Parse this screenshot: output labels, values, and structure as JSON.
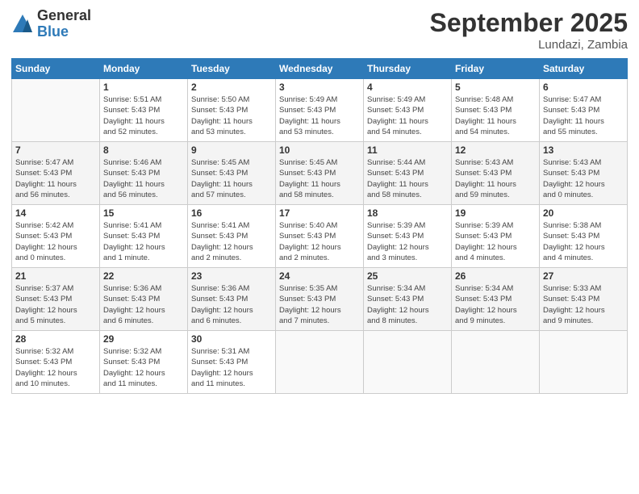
{
  "logo": {
    "general": "General",
    "blue": "Blue"
  },
  "title": "September 2025",
  "subtitle": "Lundazi, Zambia",
  "weekdays": [
    "Sunday",
    "Monday",
    "Tuesday",
    "Wednesday",
    "Thursday",
    "Friday",
    "Saturday"
  ],
  "weeks": [
    [
      {
        "num": "",
        "info": ""
      },
      {
        "num": "1",
        "info": "Sunrise: 5:51 AM\nSunset: 5:43 PM\nDaylight: 11 hours\nand 52 minutes."
      },
      {
        "num": "2",
        "info": "Sunrise: 5:50 AM\nSunset: 5:43 PM\nDaylight: 11 hours\nand 53 minutes."
      },
      {
        "num": "3",
        "info": "Sunrise: 5:49 AM\nSunset: 5:43 PM\nDaylight: 11 hours\nand 53 minutes."
      },
      {
        "num": "4",
        "info": "Sunrise: 5:49 AM\nSunset: 5:43 PM\nDaylight: 11 hours\nand 54 minutes."
      },
      {
        "num": "5",
        "info": "Sunrise: 5:48 AM\nSunset: 5:43 PM\nDaylight: 11 hours\nand 54 minutes."
      },
      {
        "num": "6",
        "info": "Sunrise: 5:47 AM\nSunset: 5:43 PM\nDaylight: 11 hours\nand 55 minutes."
      }
    ],
    [
      {
        "num": "7",
        "info": "Sunrise: 5:47 AM\nSunset: 5:43 PM\nDaylight: 11 hours\nand 56 minutes."
      },
      {
        "num": "8",
        "info": "Sunrise: 5:46 AM\nSunset: 5:43 PM\nDaylight: 11 hours\nand 56 minutes."
      },
      {
        "num": "9",
        "info": "Sunrise: 5:45 AM\nSunset: 5:43 PM\nDaylight: 11 hours\nand 57 minutes."
      },
      {
        "num": "10",
        "info": "Sunrise: 5:45 AM\nSunset: 5:43 PM\nDaylight: 11 hours\nand 58 minutes."
      },
      {
        "num": "11",
        "info": "Sunrise: 5:44 AM\nSunset: 5:43 PM\nDaylight: 11 hours\nand 58 minutes."
      },
      {
        "num": "12",
        "info": "Sunrise: 5:43 AM\nSunset: 5:43 PM\nDaylight: 11 hours\nand 59 minutes."
      },
      {
        "num": "13",
        "info": "Sunrise: 5:43 AM\nSunset: 5:43 PM\nDaylight: 12 hours\nand 0 minutes."
      }
    ],
    [
      {
        "num": "14",
        "info": "Sunrise: 5:42 AM\nSunset: 5:43 PM\nDaylight: 12 hours\nand 0 minutes."
      },
      {
        "num": "15",
        "info": "Sunrise: 5:41 AM\nSunset: 5:43 PM\nDaylight: 12 hours\nand 1 minute."
      },
      {
        "num": "16",
        "info": "Sunrise: 5:41 AM\nSunset: 5:43 PM\nDaylight: 12 hours\nand 2 minutes."
      },
      {
        "num": "17",
        "info": "Sunrise: 5:40 AM\nSunset: 5:43 PM\nDaylight: 12 hours\nand 2 minutes."
      },
      {
        "num": "18",
        "info": "Sunrise: 5:39 AM\nSunset: 5:43 PM\nDaylight: 12 hours\nand 3 minutes."
      },
      {
        "num": "19",
        "info": "Sunrise: 5:39 AM\nSunset: 5:43 PM\nDaylight: 12 hours\nand 4 minutes."
      },
      {
        "num": "20",
        "info": "Sunrise: 5:38 AM\nSunset: 5:43 PM\nDaylight: 12 hours\nand 4 minutes."
      }
    ],
    [
      {
        "num": "21",
        "info": "Sunrise: 5:37 AM\nSunset: 5:43 PM\nDaylight: 12 hours\nand 5 minutes."
      },
      {
        "num": "22",
        "info": "Sunrise: 5:36 AM\nSunset: 5:43 PM\nDaylight: 12 hours\nand 6 minutes."
      },
      {
        "num": "23",
        "info": "Sunrise: 5:36 AM\nSunset: 5:43 PM\nDaylight: 12 hours\nand 6 minutes."
      },
      {
        "num": "24",
        "info": "Sunrise: 5:35 AM\nSunset: 5:43 PM\nDaylight: 12 hours\nand 7 minutes."
      },
      {
        "num": "25",
        "info": "Sunrise: 5:34 AM\nSunset: 5:43 PM\nDaylight: 12 hours\nand 8 minutes."
      },
      {
        "num": "26",
        "info": "Sunrise: 5:34 AM\nSunset: 5:43 PM\nDaylight: 12 hours\nand 9 minutes."
      },
      {
        "num": "27",
        "info": "Sunrise: 5:33 AM\nSunset: 5:43 PM\nDaylight: 12 hours\nand 9 minutes."
      }
    ],
    [
      {
        "num": "28",
        "info": "Sunrise: 5:32 AM\nSunset: 5:43 PM\nDaylight: 12 hours\nand 10 minutes."
      },
      {
        "num": "29",
        "info": "Sunrise: 5:32 AM\nSunset: 5:43 PM\nDaylight: 12 hours\nand 11 minutes."
      },
      {
        "num": "30",
        "info": "Sunrise: 5:31 AM\nSunset: 5:43 PM\nDaylight: 12 hours\nand 11 minutes."
      },
      {
        "num": "",
        "info": ""
      },
      {
        "num": "",
        "info": ""
      },
      {
        "num": "",
        "info": ""
      },
      {
        "num": "",
        "info": ""
      }
    ]
  ]
}
